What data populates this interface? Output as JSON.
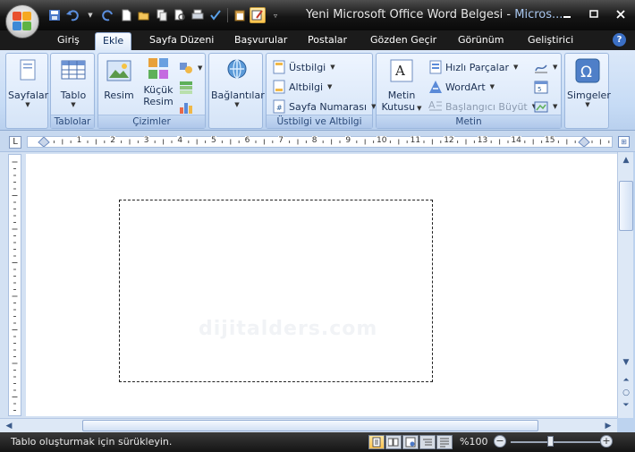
{
  "window": {
    "document_title": "Yeni Microsoft Office Word Belgesi - ",
    "app_title": "Micros..."
  },
  "quick_access_icons": [
    "save-icon",
    "undo-icon",
    "redo-icon",
    "new-document-icon",
    "open-folder-icon",
    "copy-icon",
    "print-preview-icon",
    "print-icon",
    "spellcheck-icon",
    "paste-icon",
    "draw-table-icon"
  ],
  "tabs": [
    {
      "label": "Giriş"
    },
    {
      "label": "Ekle",
      "active": true
    },
    {
      "label": "Sayfa Düzeni"
    },
    {
      "label": "Başvurular"
    },
    {
      "label": "Postalar"
    },
    {
      "label": "Gözden Geçir"
    },
    {
      "label": "Görünüm"
    },
    {
      "label": "Geliştirici"
    }
  ],
  "ribbon": {
    "pages": {
      "button": "Sayfalar"
    },
    "tables": {
      "group_label": "Tablolar",
      "button": "Tablo"
    },
    "illustrations": {
      "group_label": "Çizimler",
      "picture": "Resim",
      "clipart_line1": "Küçük",
      "clipart_line2": "Resim"
    },
    "links": {
      "button": "Bağlantılar"
    },
    "header_footer": {
      "group_label": "Üstbilgi ve Altbilgi",
      "header": "Üstbilgi",
      "footer": "Altbilgi",
      "page_number": "Sayfa Numarası"
    },
    "text": {
      "group_label": "Metin",
      "textbox_line1": "Metin",
      "textbox_line2": "Kutusu",
      "quick_parts": "Hızlı Parçalar",
      "wordart": "WordArt",
      "drop_cap": "Başlangıcı Büyüt"
    },
    "symbols": {
      "button": "Simgeler"
    }
  },
  "ruler": {
    "tab_selector": "L",
    "numbers": [
      "1",
      "2",
      "3",
      "4",
      "5",
      "6",
      "7",
      "8",
      "9",
      "10",
      "11",
      "12",
      "13",
      "14",
      "15"
    ]
  },
  "document": {
    "watermark": "dijitalders.com"
  },
  "status": {
    "text": "Tablo oluşturmak için sürükleyin.",
    "zoom": "%100",
    "zoom_minus": "−",
    "zoom_plus": "+",
    "zoom_level": 0.5
  },
  "colors": {
    "accent": "#ffc44d",
    "ribbon": "#c6dbf5",
    "titlebar": "#151515"
  }
}
